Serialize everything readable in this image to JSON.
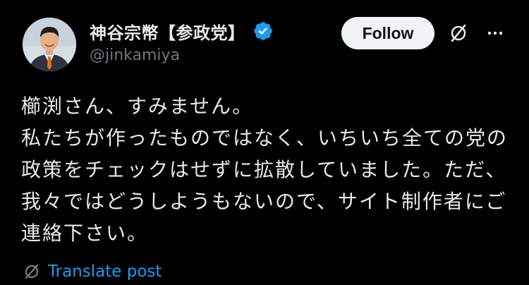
{
  "author": {
    "display_name": "神谷宗幣【参政党】",
    "handle": "@jinkamiya",
    "verified": true
  },
  "actions": {
    "follow_label": "Follow",
    "grok_icon": "grok-slash-icon",
    "more_icon": "more-dots-icon"
  },
  "post": {
    "text": "櫛渕さん、すみません。\n私たちが作ったものではなく、いちいち全ての党の政策をチェックはせずに拡散していました。ただ、我々ではどうしようもないので、サイト制作者にご連絡下さい。"
  },
  "translate": {
    "label": "Translate post"
  },
  "colors": {
    "background": "#000000",
    "text": "#e7e9ea",
    "secondary": "#71767b",
    "accent": "#1d9bf0",
    "follow_bg": "#eff3f4"
  }
}
